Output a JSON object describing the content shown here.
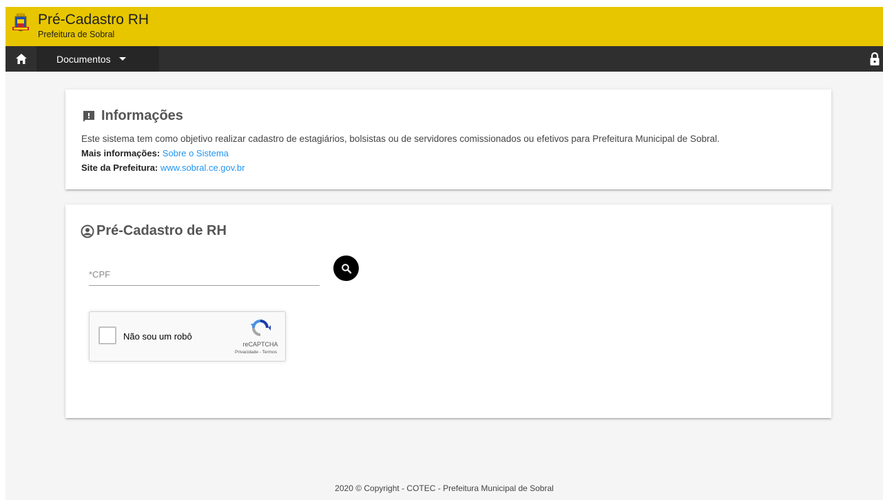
{
  "header": {
    "title": "Pré-Cadastro RH",
    "subtitle": "Prefeitura de Sobral",
    "bg_color": "#e7c600"
  },
  "navbar": {
    "home_icon": "home-icon",
    "docs_label": "Documentos",
    "lock_icon": "lock-icon",
    "bg_color": "#2f2f2f"
  },
  "info_card": {
    "title": "Informações",
    "icon": "feedback-icon",
    "description": "Este sistema tem como objetivo realizar cadastro de estagiários, bolsistas ou de servidores comissionados ou efetivos para Prefeitura Municipal de Sobral.",
    "more_label": "Mais informações:",
    "more_link": "Sobre o Sistema",
    "site_label": "Site da Prefeitura:",
    "site_link": "www.sobral.ce.gov.br",
    "link_color": "#2196f3"
  },
  "form_card": {
    "title": "Pré-Cadastro de RH",
    "icon": "user-circle-icon",
    "cpf_placeholder": "*CPF",
    "cpf_value": "",
    "search_icon": "search-icon"
  },
  "captcha": {
    "label": "Não sou um robô",
    "brand": "reCAPTCHA",
    "links": "Privacidade - Termos"
  },
  "footer": {
    "text": "2020 © Copyright - COTEC - Prefeitura Municipal de Sobral"
  }
}
